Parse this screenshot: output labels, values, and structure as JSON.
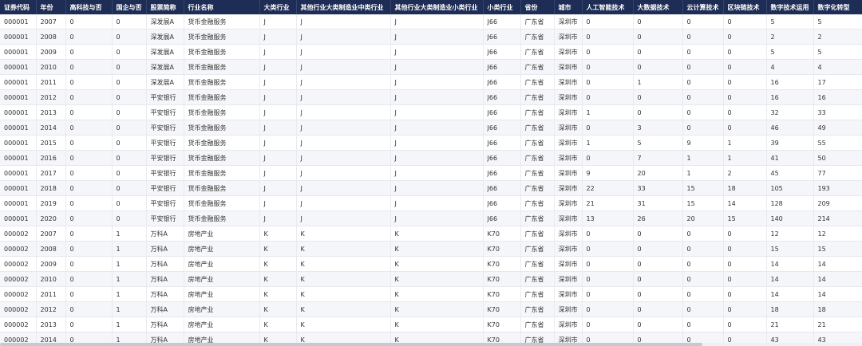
{
  "columns": [
    "证券代码",
    "年份",
    "高科技与否",
    "国企与否",
    "股票简称",
    "行业名称",
    "大类行业",
    "其他行业大类制造业中类行业",
    "其他行业大类制造业小类行业",
    "小类行业",
    "省份",
    "城市",
    "人工智能技术",
    "大数据技术",
    "云计算技术",
    "区块链技术",
    "数字技术运用",
    "数字化转型"
  ],
  "rows": [
    [
      "000001",
      "2007",
      "0",
      "0",
      "深发展A",
      "货币金融服务",
      "J",
      "J",
      "J",
      "J66",
      "广东省",
      "深圳市",
      "0",
      "0",
      "0",
      "0",
      "5",
      "5"
    ],
    [
      "000001",
      "2008",
      "0",
      "0",
      "深发展A",
      "货币金融服务",
      "J",
      "J",
      "J",
      "J66",
      "广东省",
      "深圳市",
      "0",
      "0",
      "0",
      "0",
      "2",
      "2"
    ],
    [
      "000001",
      "2009",
      "0",
      "0",
      "深发展A",
      "货币金融服务",
      "J",
      "J",
      "J",
      "J66",
      "广东省",
      "深圳市",
      "0",
      "0",
      "0",
      "0",
      "5",
      "5"
    ],
    [
      "000001",
      "2010",
      "0",
      "0",
      "深发展A",
      "货币金融服务",
      "J",
      "J",
      "J",
      "J66",
      "广东省",
      "深圳市",
      "0",
      "0",
      "0",
      "0",
      "4",
      "4"
    ],
    [
      "000001",
      "2011",
      "0",
      "0",
      "深发展A",
      "货币金融服务",
      "J",
      "J",
      "J",
      "J66",
      "广东省",
      "深圳市",
      "0",
      "1",
      "0",
      "0",
      "16",
      "17"
    ],
    [
      "000001",
      "2012",
      "0",
      "0",
      "平安银行",
      "货币金融服务",
      "J",
      "J",
      "J",
      "J66",
      "广东省",
      "深圳市",
      "0",
      "0",
      "0",
      "0",
      "16",
      "16"
    ],
    [
      "000001",
      "2013",
      "0",
      "0",
      "平安银行",
      "货币金融服务",
      "J",
      "J",
      "J",
      "J66",
      "广东省",
      "深圳市",
      "1",
      "0",
      "0",
      "0",
      "32",
      "33"
    ],
    [
      "000001",
      "2014",
      "0",
      "0",
      "平安银行",
      "货币金融服务",
      "J",
      "J",
      "J",
      "J66",
      "广东省",
      "深圳市",
      "0",
      "3",
      "0",
      "0",
      "46",
      "49"
    ],
    [
      "000001",
      "2015",
      "0",
      "0",
      "平安银行",
      "货币金融服务",
      "J",
      "J",
      "J",
      "J66",
      "广东省",
      "深圳市",
      "1",
      "5",
      "9",
      "1",
      "39",
      "55"
    ],
    [
      "000001",
      "2016",
      "0",
      "0",
      "平安银行",
      "货币金融服务",
      "J",
      "J",
      "J",
      "J66",
      "广东省",
      "深圳市",
      "0",
      "7",
      "1",
      "1",
      "41",
      "50"
    ],
    [
      "000001",
      "2017",
      "0",
      "0",
      "平安银行",
      "货币金融服务",
      "J",
      "J",
      "J",
      "J66",
      "广东省",
      "深圳市",
      "9",
      "20",
      "1",
      "2",
      "45",
      "77"
    ],
    [
      "000001",
      "2018",
      "0",
      "0",
      "平安银行",
      "货币金融服务",
      "J",
      "J",
      "J",
      "J66",
      "广东省",
      "深圳市",
      "22",
      "33",
      "15",
      "18",
      "105",
      "193"
    ],
    [
      "000001",
      "2019",
      "0",
      "0",
      "平安银行",
      "货币金融服务",
      "J",
      "J",
      "J",
      "J66",
      "广东省",
      "深圳市",
      "21",
      "31",
      "15",
      "14",
      "128",
      "209"
    ],
    [
      "000001",
      "2020",
      "0",
      "0",
      "平安银行",
      "货币金融服务",
      "J",
      "J",
      "J",
      "J66",
      "广东省",
      "深圳市",
      "13",
      "26",
      "20",
      "15",
      "140",
      "214"
    ],
    [
      "000002",
      "2007",
      "0",
      "1",
      "万科A",
      "房地产业",
      "K",
      "K",
      "K",
      "K70",
      "广东省",
      "深圳市",
      "0",
      "0",
      "0",
      "0",
      "12",
      "12"
    ],
    [
      "000002",
      "2008",
      "0",
      "1",
      "万科A",
      "房地产业",
      "K",
      "K",
      "K",
      "K70",
      "广东省",
      "深圳市",
      "0",
      "0",
      "0",
      "0",
      "15",
      "15"
    ],
    [
      "000002",
      "2009",
      "0",
      "1",
      "万科A",
      "房地产业",
      "K",
      "K",
      "K",
      "K70",
      "广东省",
      "深圳市",
      "0",
      "0",
      "0",
      "0",
      "14",
      "14"
    ],
    [
      "000002",
      "2010",
      "0",
      "1",
      "万科A",
      "房地产业",
      "K",
      "K",
      "K",
      "K70",
      "广东省",
      "深圳市",
      "0",
      "0",
      "0",
      "0",
      "14",
      "14"
    ],
    [
      "000002",
      "2011",
      "0",
      "1",
      "万科A",
      "房地产业",
      "K",
      "K",
      "K",
      "K70",
      "广东省",
      "深圳市",
      "0",
      "0",
      "0",
      "0",
      "14",
      "14"
    ],
    [
      "000002",
      "2012",
      "0",
      "1",
      "万科A",
      "房地产业",
      "K",
      "K",
      "K",
      "K70",
      "广东省",
      "深圳市",
      "0",
      "0",
      "0",
      "0",
      "18",
      "18"
    ],
    [
      "000002",
      "2013",
      "0",
      "1",
      "万科A",
      "房地产业",
      "K",
      "K",
      "K",
      "K70",
      "广东省",
      "深圳市",
      "0",
      "0",
      "0",
      "0",
      "21",
      "21"
    ],
    [
      "000002",
      "2014",
      "0",
      "1",
      "万科A",
      "房地产业",
      "K",
      "K",
      "K",
      "K70",
      "广东省",
      "深圳市",
      "0",
      "0",
      "0",
      "0",
      "43",
      "43"
    ]
  ]
}
